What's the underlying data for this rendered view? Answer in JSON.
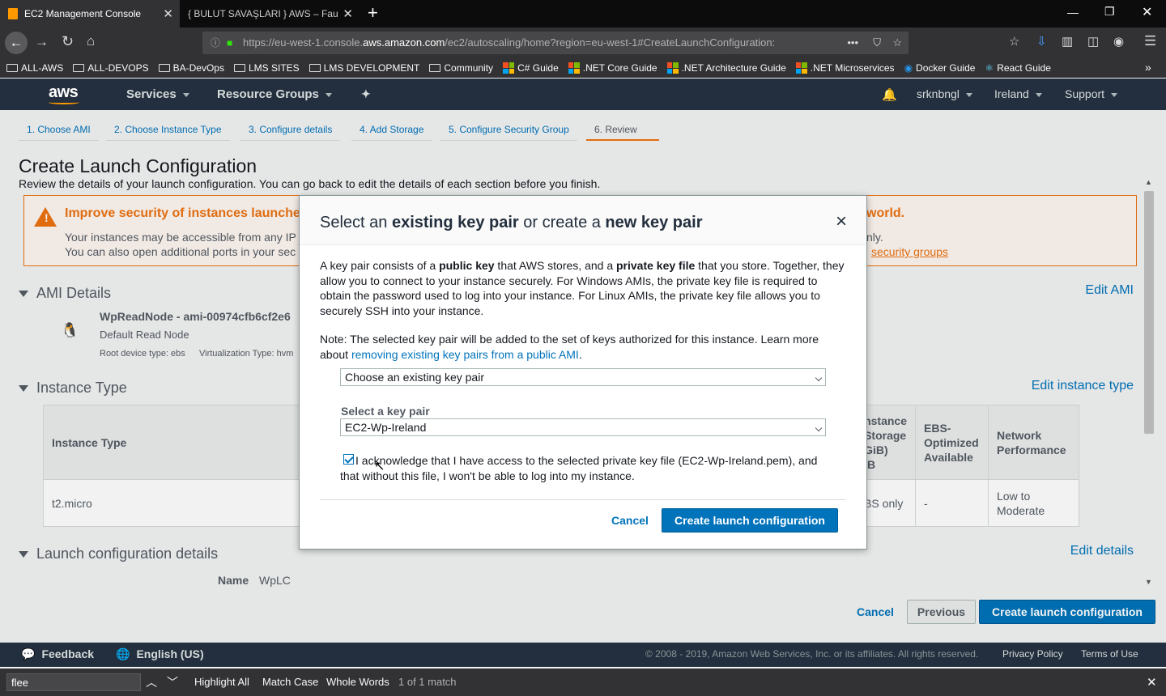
{
  "browser": {
    "tabs": [
      {
        "title": "EC2 Management Console",
        "active": true
      },
      {
        "title": "{ BULUT SAVAŞLARI } AWS – Fault T",
        "active": false
      }
    ],
    "new_tab": "+",
    "url_prefix": "https://eu-west-1.console.",
    "url_domain": "aws.amazon.com",
    "url_path": "/ec2/autoscaling/home?region=eu-west-1#CreateLaunchConfiguration:",
    "url_more": "•••"
  },
  "bookmarks": [
    {
      "label": "ALL-AWS",
      "type": "folder"
    },
    {
      "label": "ALL-DEVOPS",
      "type": "folder"
    },
    {
      "label": "BA-DevOps",
      "type": "folder"
    },
    {
      "label": "LMS SITES",
      "type": "folder"
    },
    {
      "label": "LMS DEVELOPMENT",
      "type": "folder"
    },
    {
      "label": "Community",
      "type": "folder"
    },
    {
      "label": "C# Guide",
      "type": "ms"
    },
    {
      "label": ".NET Core Guide",
      "type": "ms"
    },
    {
      "label": ".NET Architecture Guide",
      "type": "ms"
    },
    {
      "label": ".NET Microservices",
      "type": "ms"
    },
    {
      "label": "Docker Guide",
      "type": "docker"
    },
    {
      "label": "React Guide",
      "type": "react"
    }
  ],
  "aws_nav": {
    "logo": "aws",
    "services": "Services",
    "resource_groups": "Resource Groups",
    "user": "srknbngl",
    "region": "Ireland",
    "support": "Support"
  },
  "steps": [
    "1. Choose AMI",
    "2. Choose Instance Type",
    "3. Configure details",
    "4. Add Storage",
    "5. Configure Security Group",
    "6. Review"
  ],
  "page": {
    "title": "Create Launch Configuration",
    "subtitle": "Review the details of your launch configuration. You can go back to edit the details of each section before you finish.",
    "warning_title": "Improve security of instances launche",
    "warning_title_end": "world.",
    "warning_line1": "Your instances may be accessible from any IP",
    "warning_line1_end": "nly.",
    "warning_line2": "You can also open additional ports in your sec",
    "warning_link": "security groups"
  },
  "ami": {
    "section": "AMI Details",
    "edit": "Edit AMI",
    "name": "WpReadNode - ami-00974cfb6cf2e6",
    "desc": "Default Read Node",
    "root": "Root device type: ebs",
    "virt": "Virtualization Type: hvm"
  },
  "instance": {
    "section": "Instance Type",
    "edit": "Edit instance type",
    "headers": [
      "Instance Type",
      "nstance\nStorage\nGiB)\niB",
      "EBS-\nOptimized\nAvailable",
      "Network\nPerformance"
    ],
    "row": [
      "t2.micro",
      "BS only",
      "-",
      "Low to\nModerate"
    ]
  },
  "launch": {
    "section": "Launch configuration details",
    "edit": "Edit details",
    "name_label": "Name",
    "name_value": "WpLC"
  },
  "actions": {
    "cancel": "Cancel",
    "previous": "Previous",
    "create": "Create launch configuration"
  },
  "modal": {
    "title_a": "Select an ",
    "title_b": "existing key pair",
    "title_c": " or create a ",
    "title_d": "new key pair",
    "close": "×",
    "p1_a": "A key pair consists of a ",
    "p1_b": "public key",
    "p1_c": " that AWS stores, and a ",
    "p1_d": "private key file",
    "p1_e": " that you store. Together, they allow you to connect to your instance securely. For Windows AMIs, the private key file is required to obtain the password used to log into your instance. For Linux AMIs, the private key file allows you to securely SSH into your instance.",
    "p2": "Note: The selected key pair will be added to the set of keys authorized for this instance. Learn more about ",
    "p2_link": "removing existing key pairs from a public AMI",
    "p2_end": ".",
    "mode_select": "Choose an existing key pair",
    "keypair_label": "Select a key pair",
    "keypair_value": "EC2-Wp-Ireland",
    "ack": "I acknowledge that I have access to the selected private key file (EC2-Wp-Ireland.pem), and that without this file, I won't be able to log into my instance.",
    "ack_checked": true,
    "cancel": "Cancel",
    "create": "Create launch configuration"
  },
  "footer": {
    "feedback": "Feedback",
    "language": "English (US)",
    "copyright": "© 2008 - 2019, Amazon Web Services, Inc. or its affiliates. All rights reserved.",
    "privacy": "Privacy Policy",
    "terms": "Terms of Use"
  },
  "findbar": {
    "query": "flee",
    "highlight_all": "Highlight All",
    "match_case": "Match Case",
    "whole_words": "Whole Words",
    "result": "1 of 1 match"
  }
}
